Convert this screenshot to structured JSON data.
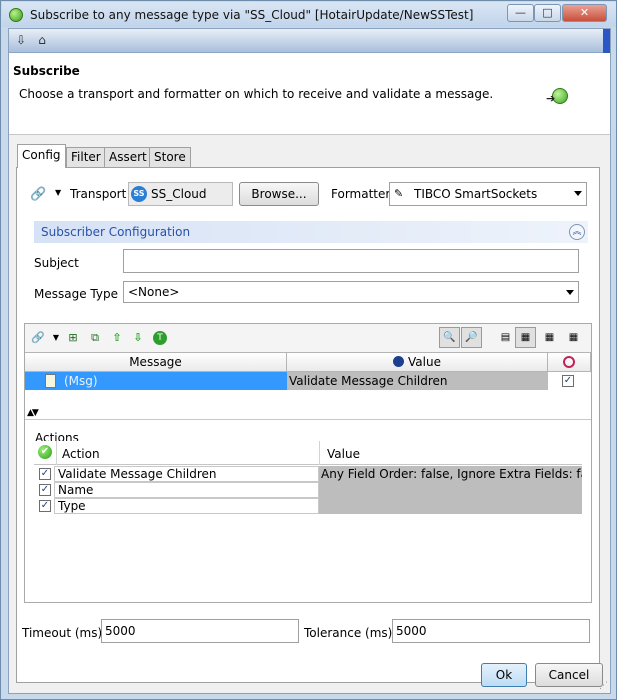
{
  "window": {
    "title": "Subscribe to any message type via \"SS_Cloud\" [HotairUpdate/NewSSTest]",
    "min_glyph": "—",
    "max_glyph": "□",
    "close_glyph": "✕"
  },
  "header": {
    "title": "Subscribe",
    "description": "Choose a transport and formatter on which to receive and validate a message."
  },
  "tabs": [
    {
      "label": "Config",
      "active": true
    },
    {
      "label": "Filter",
      "active": false
    },
    {
      "label": "Assert",
      "active": false
    },
    {
      "label": "Store",
      "active": false
    }
  ],
  "transport": {
    "label": "Transport",
    "value": "SS_Cloud",
    "icon_text": "SS",
    "browse_label": "Browse...",
    "formatter_label": "Formatter",
    "formatter_value": "TIBCO SmartSockets"
  },
  "subscriber_config": {
    "title": "Subscriber Configuration",
    "subject_label": "Subject",
    "subject_value": "",
    "message_type_label": "Message Type",
    "message_type_value": "<None>"
  },
  "tree": {
    "columns": [
      "Message",
      "Value"
    ],
    "row": {
      "message": "(Msg)",
      "value": "Validate Message Children",
      "checked": true
    }
  },
  "actions": {
    "label": "Actions",
    "columns": [
      "Action",
      "Value"
    ],
    "rows": [
      {
        "name": "Validate Message Children",
        "value": "Any Field Order: false, Ignore Extra Fields: false,",
        "checked": true
      },
      {
        "name": "Name",
        "value": "",
        "checked": true
      },
      {
        "name": "Type",
        "value": "",
        "checked": true
      }
    ]
  },
  "timing": {
    "timeout_label": "Timeout (ms)",
    "timeout_value": "5000",
    "tolerance_label": "Tolerance (ms)",
    "tolerance_value": "5000"
  },
  "buttons": {
    "ok": "Ok",
    "cancel": "Cancel"
  }
}
